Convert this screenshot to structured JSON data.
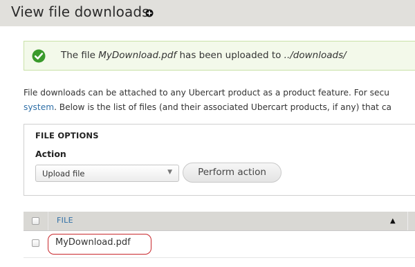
{
  "header": {
    "title": "View file downloads",
    "add_icon": "plus-circle-icon"
  },
  "status": {
    "icon": "check-circle-icon",
    "text_before": "The file ",
    "filename": "MyDownload.pdf",
    "text_middle": " has been uploaded to ",
    "path": "../downloads/"
  },
  "description": {
    "line1": "File downloads can be attached to any Ubercart product as a product feature. For secu",
    "link": "system",
    "line2_rest": ". Below is the list of files (and their associated Ubercart products, if any) that ca"
  },
  "file_options": {
    "legend": "FILE OPTIONS",
    "action_label": "Action",
    "select_value": "Upload file",
    "button_label": "Perform action"
  },
  "table": {
    "column_file": "FILE",
    "sort_icon": "sort-ascending-icon",
    "rows": [
      {
        "file": "MyDownload.pdf"
      }
    ]
  },
  "colors": {
    "header_bg": "#e1e0dc",
    "status_bg": "#f3f9ea",
    "status_icon": "#3a9a2c",
    "link": "#2f6fa7",
    "highlight": "#c8262b"
  }
}
